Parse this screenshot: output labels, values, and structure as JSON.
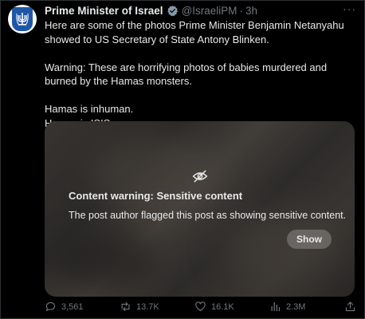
{
  "author": {
    "name": "Prime Minister of Israel",
    "handle": "@IsraeliPM",
    "separator": "·",
    "time": "3h",
    "avatar_icon": "state-emblem-icon",
    "verified_icon": "verified-badge-icon"
  },
  "more_icon": "more-horizontal-icon",
  "more_label": "···",
  "tweet": {
    "paragraph_1": "Here are some of the photos Prime Minister Benjamin Netanyahu showed to US Secretary of State Antony Blinken.",
    "paragraph_2": "Warning: These are horrifying photos of babies murdered and burned by the Hamas monsters.",
    "paragraph_3": "Hamas is inhuman.\nHamas is ISIS."
  },
  "media": {
    "icon": "eye-slash-icon",
    "warning_title": "Content warning: Sensitive content",
    "warning_description": "The post author flagged this post as showing sensitive content.",
    "show_label": "Show"
  },
  "actions": {
    "replies": {
      "icon": "reply-icon",
      "count": "3,561"
    },
    "reposts": {
      "icon": "repost-icon",
      "count": "13.7K"
    },
    "likes": {
      "icon": "heart-icon",
      "count": "16.1K"
    },
    "views": {
      "icon": "views-icon",
      "count": "2.3M"
    },
    "share": {
      "icon": "share-icon"
    }
  },
  "colors": {
    "background": "#000000",
    "text": "#e7e9ea",
    "secondary": "#71767b",
    "verified": "#829aab"
  }
}
